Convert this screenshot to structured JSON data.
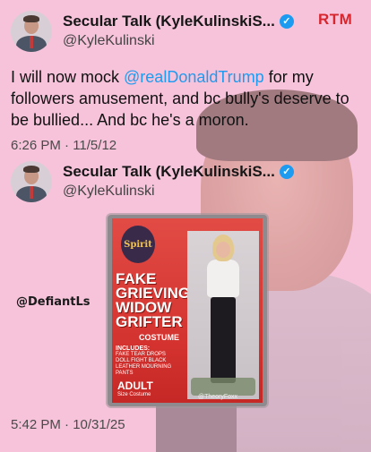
{
  "watermark_top": "RTM",
  "watermark_side": "@DefiantLs",
  "tweets": [
    {
      "name": "Secular Talk (KyleKulinskiS...",
      "handle": "@KyleKulinski",
      "text_before": "I will now mock ",
      "mention": "@realDonaldTrump",
      "text_after": " for my followers amusement, and bc bully's deserve to be bullied... And bc he's a moron.",
      "timestamp": "6:26 PM · 11/5/12"
    },
    {
      "name": "Secular Talk (KyleKulinskiS...",
      "handle": "@KyleKulinski",
      "timestamp": "5:42 PM · 10/31/25"
    }
  ],
  "costume_image": {
    "brand": "Spirit",
    "title": "FAKE GRIEVING WIDOW GRIFTER",
    "subtitle": "COSTUME",
    "includes_title": "INCLUDES:",
    "includes": [
      "FAKE TEAR DROPS",
      "DOLL FIGHT BLACK",
      "LEATHER MOURNING PANTS"
    ],
    "adult": "ADULT",
    "size": "Size Costume",
    "watermark": "@TheoryFoxx"
  },
  "colors": {
    "background": "#f7c3da",
    "mention": "#1d9bf0",
    "verified": "#1d9bf0",
    "rtm": "#d8262e"
  },
  "icons": [
    "verified-badge-icon"
  ]
}
